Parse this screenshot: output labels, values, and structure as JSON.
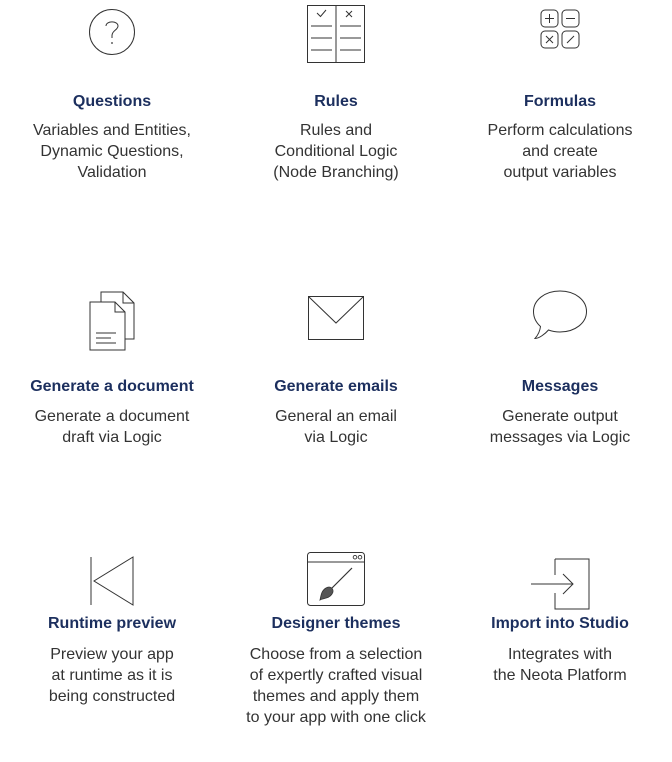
{
  "features": [
    {
      "icon": "question-circle-icon",
      "title": "Questions",
      "description": "Variables and Entities,\nDynamic Questions,\nValidation"
    },
    {
      "icon": "rules-checklist-icon",
      "title": "Rules",
      "description": "Rules and\nConditional Logic\n(Node Branching)"
    },
    {
      "icon": "math-operators-icon",
      "title": "Formulas",
      "description": "Perform calculations\nand create\noutput variables"
    },
    {
      "icon": "document-pages-icon",
      "title": "Generate a document",
      "description": "Generate a document\ndraft via Logic"
    },
    {
      "icon": "envelope-icon",
      "title": "Generate emails",
      "description": "General an email\nvia Logic"
    },
    {
      "icon": "speech-bubble-icon",
      "title": "Messages",
      "description": "Generate output\nmessages via Logic"
    },
    {
      "icon": "play-back-icon",
      "title": "Runtime preview",
      "description": "Preview your app\nat runtime as it is\nbeing constructed"
    },
    {
      "icon": "browser-brush-icon",
      "title": "Designer themes",
      "description": "Choose from a selection\nof expertly crafted visual\nthemes and apply them\nto your app with one click"
    },
    {
      "icon": "import-arrow-icon",
      "title": "Import into Studio",
      "description": "Integrates with\nthe Neota Platform"
    }
  ]
}
